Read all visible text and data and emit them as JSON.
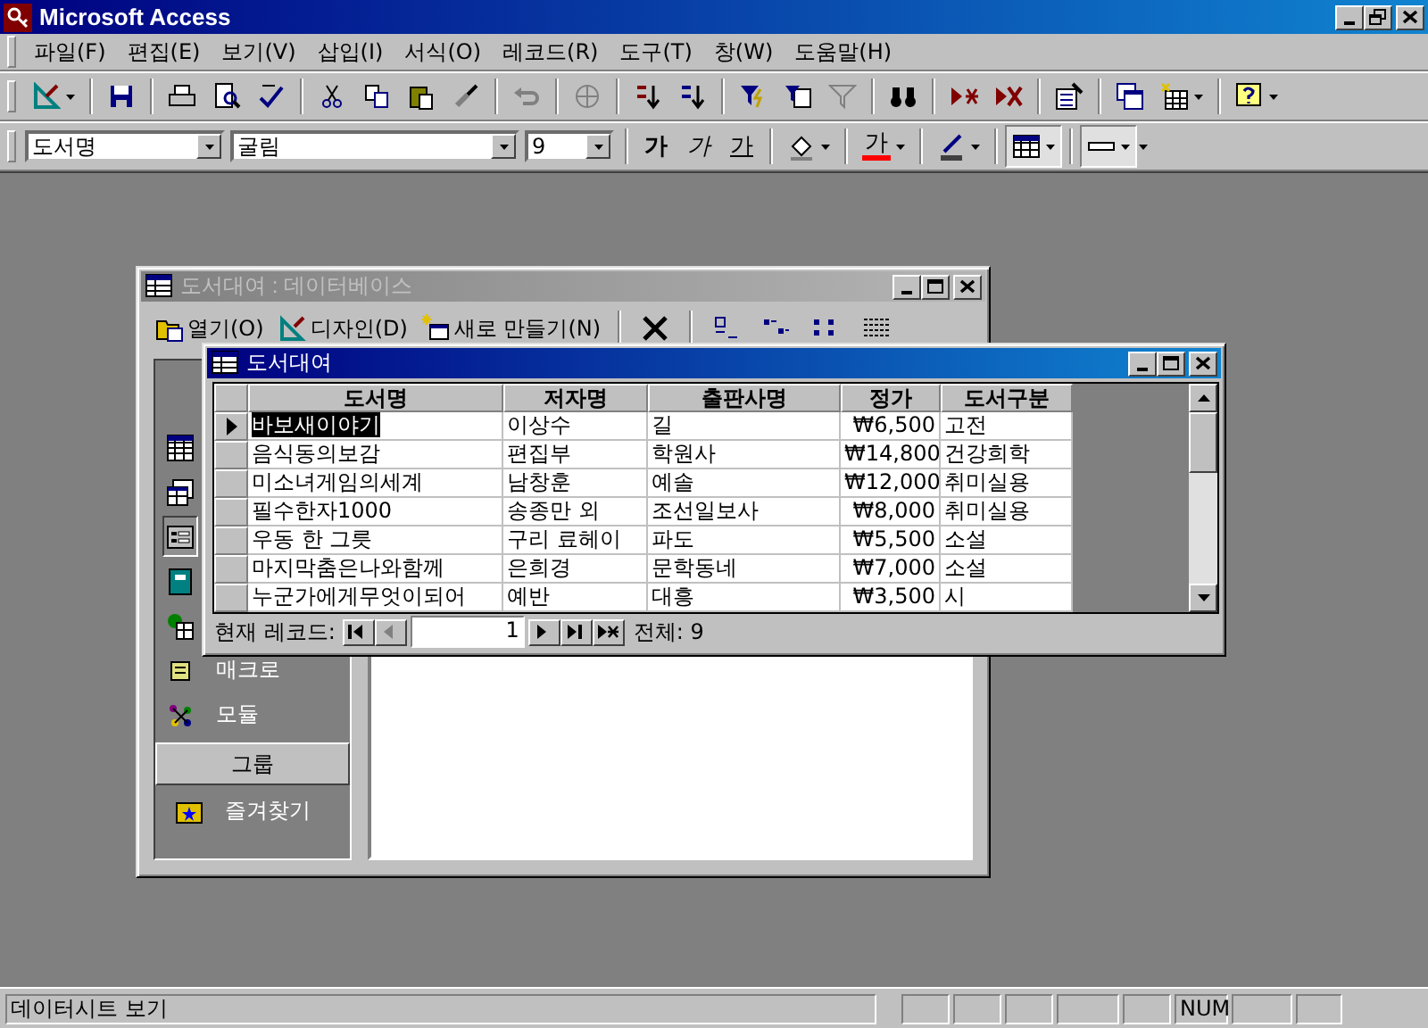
{
  "app": {
    "title": "Microsoft Access"
  },
  "menu": [
    "파일(F)",
    "편집(E)",
    "보기(V)",
    "삽입(I)",
    "서식(O)",
    "레코드(R)",
    "도구(T)",
    "창(W)",
    "도움말(H)"
  ],
  "format_toolbar": {
    "object_combo": "도서명",
    "font_combo": "굴림",
    "size_combo": "9",
    "style_buttons": [
      {
        "kind": "bold",
        "label": "가"
      },
      {
        "kind": "italic",
        "label": "가"
      },
      {
        "kind": "underline",
        "label": "가"
      }
    ],
    "font_color_label": "가"
  },
  "database_window": {
    "title": "도서대여 : 데이터베이스",
    "active": false,
    "toolbar": [
      {
        "kind": "open",
        "label": "열기(O)"
      },
      {
        "kind": "design",
        "label": "디자인(D)"
      },
      {
        "kind": "new",
        "label": "새로 만들기(N)"
      }
    ],
    "objects": [
      {
        "kind": "table",
        "selected": false
      },
      {
        "kind": "query",
        "selected": false
      },
      {
        "kind": "form",
        "selected": true
      },
      {
        "kind": "report",
        "selected": false
      },
      {
        "kind": "page",
        "selected": false
      },
      {
        "kind": "macro",
        "selected": false,
        "label": "매크로"
      },
      {
        "kind": "module",
        "selected": false,
        "label": "모듈"
      }
    ],
    "group_header": "그룹",
    "groups": [
      {
        "label": "즐겨찾기"
      }
    ]
  },
  "datasheet_window": {
    "title": "도서대여",
    "active": true,
    "columns": [
      {
        "label": "도서명",
        "kind": "text"
      },
      {
        "label": "저자명",
        "kind": "text"
      },
      {
        "label": "출판사명",
        "kind": "text"
      },
      {
        "label": "정가",
        "kind": "currency"
      },
      {
        "label": "도서구분",
        "kind": "text"
      }
    ],
    "rows": [
      {
        "selected": true,
        "cells": [
          "바보새이야기",
          "이상수",
          "길",
          "₩6,500",
          "고전"
        ]
      },
      {
        "selected": false,
        "cells": [
          "음식동의보감",
          "편집부",
          "학원사",
          "₩14,800",
          "건강희학"
        ]
      },
      {
        "selected": false,
        "cells": [
          "미소녀게임의세계",
          "남창훈",
          "예솔",
          "₩12,000",
          "취미실용"
        ]
      },
      {
        "selected": false,
        "cells": [
          "필수한자1000",
          "송종만 외",
          "조선일보사",
          "₩8,000",
          "취미실용"
        ]
      },
      {
        "selected": false,
        "cells": [
          "우동 한 그릇",
          "구리 료헤이",
          "파도",
          "₩5,500",
          "소설"
        ]
      },
      {
        "selected": false,
        "cells": [
          "마지막춤은나와함께",
          "은희경",
          "문학동네",
          "₩7,000",
          "소설"
        ]
      },
      {
        "selected": false,
        "cells": [
          "누군가에게무엇이되어",
          "예반",
          "대흥",
          "₩3,500",
          "시"
        ]
      }
    ],
    "navigation": {
      "label": "현재 레코드:",
      "record": "1",
      "total": "전체: 9",
      "buttons": [
        {
          "kind": "first",
          "disabled": false
        },
        {
          "kind": "prev",
          "disabled": true
        },
        {
          "kind": "next",
          "disabled": false
        },
        {
          "kind": "last",
          "disabled": false
        },
        {
          "kind": "new",
          "disabled": false
        }
      ]
    }
  },
  "status_bar": {
    "text": "데이터시트 보기",
    "indicators": [
      {
        "label": "NUM",
        "on": true
      }
    ]
  }
}
